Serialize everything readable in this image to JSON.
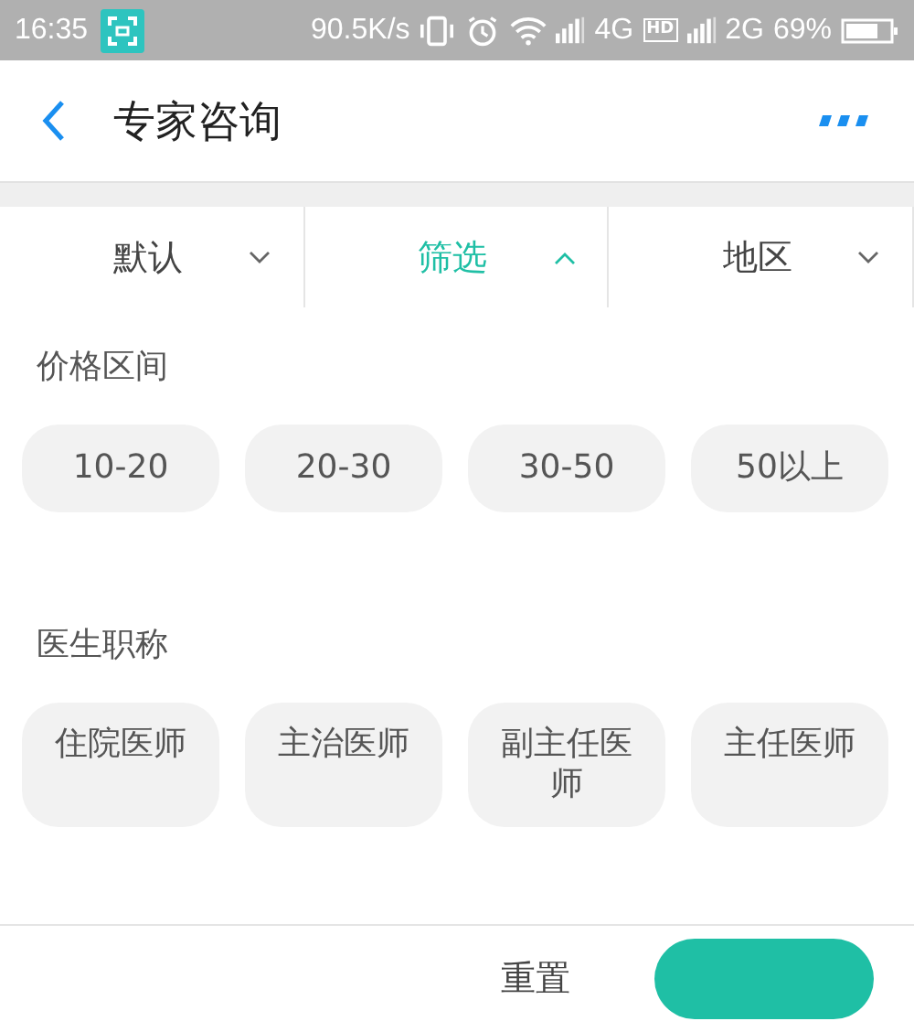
{
  "status_bar": {
    "time": "16:35",
    "speed": "90.5K/s",
    "sim1": "4G",
    "hd": "HD",
    "sim2": "2G",
    "battery": "69%"
  },
  "nav": {
    "title": "专家咨询"
  },
  "tabs": [
    {
      "label": "默认",
      "selected": false
    },
    {
      "label": "筛选",
      "selected": true
    },
    {
      "label": "地区",
      "selected": false
    }
  ],
  "sections": [
    {
      "title": "价格区间",
      "options": [
        {
          "label": "10-20",
          "selected": false
        },
        {
          "label": "20-30",
          "selected": false
        },
        {
          "label": "30-50",
          "selected": false
        },
        {
          "label": "50以上",
          "selected": false
        }
      ]
    },
    {
      "title": "医生职称",
      "options": [
        {
          "label": "住院医师",
          "selected": false
        },
        {
          "label": "主治医师",
          "selected": false
        },
        {
          "label": "副主任医师",
          "selected": false
        },
        {
          "label": "主任医师",
          "selected": false
        }
      ]
    }
  ],
  "footer": {
    "reset": "重置"
  }
}
